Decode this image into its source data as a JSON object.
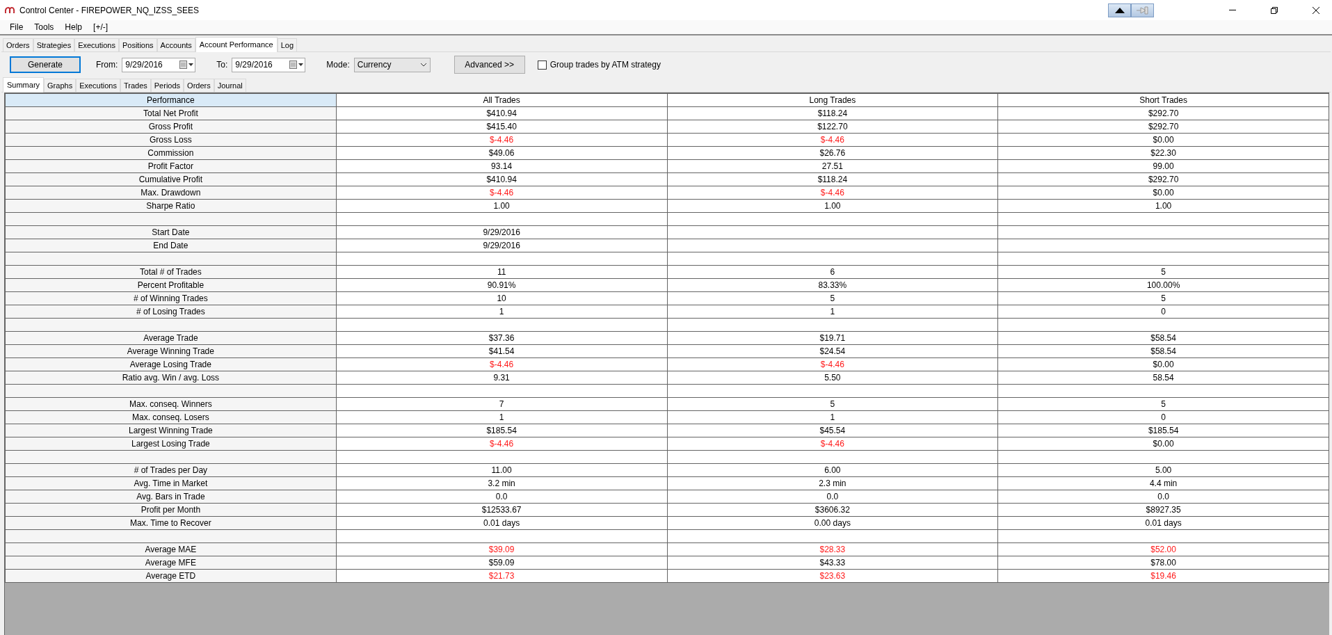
{
  "window": {
    "title": "Control Center - FIREPOWER_NQ_IZSS_SEES"
  },
  "menu": [
    "File",
    "Tools",
    "Help",
    "[+/-]"
  ],
  "tabs": [
    {
      "label": "Orders",
      "selected": false
    },
    {
      "label": "Strategies",
      "selected": false
    },
    {
      "label": "Executions",
      "selected": false
    },
    {
      "label": "Positions",
      "selected": false
    },
    {
      "label": "Accounts",
      "selected": false
    },
    {
      "label": "Account Performance",
      "selected": true
    },
    {
      "label": "Log",
      "selected": false
    }
  ],
  "toolbar": {
    "generate": "Generate",
    "from_label": "From:",
    "from": "9/29/2016",
    "to_label": "To:",
    "to": "9/29/2016",
    "mode_label": "Mode:",
    "mode": "Currency",
    "advanced": "Advanced >>",
    "group_atm": {
      "label": "Group trades by ATM strategy",
      "checked": false
    }
  },
  "subtabs": [
    {
      "label": "Summary",
      "selected": true
    },
    {
      "label": "Graphs",
      "selected": false
    },
    {
      "label": "Executions",
      "selected": false
    },
    {
      "label": "Trades",
      "selected": false
    },
    {
      "label": "Periods",
      "selected": false
    },
    {
      "label": "Orders",
      "selected": false
    },
    {
      "label": "Journal",
      "selected": false
    }
  ],
  "table": {
    "columns": [
      "Performance",
      "All Trades",
      "Long Trades",
      "Short Trades"
    ],
    "rows": [
      {
        "kind": "data",
        "label": "Total Net Profit",
        "values": [
          {
            "text": "$410.94",
            "negative": false
          },
          {
            "text": "$118.24",
            "negative": false
          },
          {
            "text": "$292.70",
            "negative": false
          }
        ]
      },
      {
        "kind": "data",
        "label": "Gross Profit",
        "values": [
          {
            "text": "$415.40",
            "negative": false
          },
          {
            "text": "$122.70",
            "negative": false
          },
          {
            "text": "$292.70",
            "negative": false
          }
        ]
      },
      {
        "kind": "data",
        "label": "Gross Loss",
        "values": [
          {
            "text": "$-4.46",
            "negative": true
          },
          {
            "text": "$-4.46",
            "negative": true
          },
          {
            "text": "$0.00",
            "negative": false
          }
        ]
      },
      {
        "kind": "data",
        "label": "Commission",
        "values": [
          {
            "text": "$49.06",
            "negative": false
          },
          {
            "text": "$26.76",
            "negative": false
          },
          {
            "text": "$22.30",
            "negative": false
          }
        ]
      },
      {
        "kind": "data",
        "label": "Profit Factor",
        "values": [
          {
            "text": "93.14",
            "negative": false
          },
          {
            "text": "27.51",
            "negative": false
          },
          {
            "text": "99.00",
            "negative": false
          }
        ]
      },
      {
        "kind": "data",
        "label": "Cumulative Profit",
        "values": [
          {
            "text": "$410.94",
            "negative": false
          },
          {
            "text": "$118.24",
            "negative": false
          },
          {
            "text": "$292.70",
            "negative": false
          }
        ]
      },
      {
        "kind": "data",
        "label": "Max. Drawdown",
        "values": [
          {
            "text": "$-4.46",
            "negative": true
          },
          {
            "text": "$-4.46",
            "negative": true
          },
          {
            "text": "$0.00",
            "negative": false
          }
        ]
      },
      {
        "kind": "data",
        "label": "Sharpe Ratio",
        "values": [
          {
            "text": "1.00",
            "negative": false
          },
          {
            "text": "1.00",
            "negative": false
          },
          {
            "text": "1.00",
            "negative": false
          }
        ]
      },
      {
        "kind": "blank"
      },
      {
        "kind": "data",
        "label": "Start Date",
        "values": [
          {
            "text": "9/29/2016",
            "negative": false
          }
        ]
      },
      {
        "kind": "data",
        "label": "End Date",
        "values": [
          {
            "text": "9/29/2016",
            "negative": false
          }
        ]
      },
      {
        "kind": "blank"
      },
      {
        "kind": "data",
        "label": "Total # of Trades",
        "values": [
          {
            "text": "11",
            "negative": false
          },
          {
            "text": "6",
            "negative": false
          },
          {
            "text": "5",
            "negative": false
          }
        ]
      },
      {
        "kind": "data",
        "label": "Percent Profitable",
        "values": [
          {
            "text": "90.91%",
            "negative": false
          },
          {
            "text": "83.33%",
            "negative": false
          },
          {
            "text": "100.00%",
            "negative": false
          }
        ]
      },
      {
        "kind": "data",
        "label": "# of Winning Trades",
        "values": [
          {
            "text": "10",
            "negative": false
          },
          {
            "text": "5",
            "negative": false
          },
          {
            "text": "5",
            "negative": false
          }
        ]
      },
      {
        "kind": "data",
        "label": "# of Losing Trades",
        "values": [
          {
            "text": "1",
            "negative": false
          },
          {
            "text": "1",
            "negative": false
          },
          {
            "text": "0",
            "negative": false
          }
        ]
      },
      {
        "kind": "blank"
      },
      {
        "kind": "data",
        "label": "Average Trade",
        "values": [
          {
            "text": "$37.36",
            "negative": false
          },
          {
            "text": "$19.71",
            "negative": false
          },
          {
            "text": "$58.54",
            "negative": false
          }
        ]
      },
      {
        "kind": "data",
        "label": "Average Winning Trade",
        "values": [
          {
            "text": "$41.54",
            "negative": false
          },
          {
            "text": "$24.54",
            "negative": false
          },
          {
            "text": "$58.54",
            "negative": false
          }
        ]
      },
      {
        "kind": "data",
        "label": "Average Losing Trade",
        "values": [
          {
            "text": "$-4.46",
            "negative": true
          },
          {
            "text": "$-4.46",
            "negative": true
          },
          {
            "text": "$0.00",
            "negative": false
          }
        ]
      },
      {
        "kind": "data",
        "label": "Ratio avg. Win / avg. Loss",
        "values": [
          {
            "text": "9.31",
            "negative": false
          },
          {
            "text": "5.50",
            "negative": false
          },
          {
            "text": "58.54",
            "negative": false
          }
        ]
      },
      {
        "kind": "blank"
      },
      {
        "kind": "data",
        "label": "Max. conseq. Winners",
        "values": [
          {
            "text": "7",
            "negative": false
          },
          {
            "text": "5",
            "negative": false
          },
          {
            "text": "5",
            "negative": false
          }
        ]
      },
      {
        "kind": "data",
        "label": "Max. conseq. Losers",
        "values": [
          {
            "text": "1",
            "negative": false
          },
          {
            "text": "1",
            "negative": false
          },
          {
            "text": "0",
            "negative": false
          }
        ]
      },
      {
        "kind": "data",
        "label": "Largest Winning Trade",
        "values": [
          {
            "text": "$185.54",
            "negative": false
          },
          {
            "text": "$45.54",
            "negative": false
          },
          {
            "text": "$185.54",
            "negative": false
          }
        ]
      },
      {
        "kind": "data",
        "label": "Largest Losing Trade",
        "values": [
          {
            "text": "$-4.46",
            "negative": true
          },
          {
            "text": "$-4.46",
            "negative": true
          },
          {
            "text": "$0.00",
            "negative": false
          }
        ]
      },
      {
        "kind": "blank"
      },
      {
        "kind": "data",
        "label": "# of Trades per Day",
        "values": [
          {
            "text": "11.00",
            "negative": false
          },
          {
            "text": "6.00",
            "negative": false
          },
          {
            "text": "5.00",
            "negative": false
          }
        ]
      },
      {
        "kind": "data",
        "label": "Avg. Time in Market",
        "values": [
          {
            "text": "3.2 min",
            "negative": false
          },
          {
            "text": "2.3 min",
            "negative": false
          },
          {
            "text": "4.4 min",
            "negative": false
          }
        ]
      },
      {
        "kind": "data",
        "label": "Avg. Bars in Trade",
        "values": [
          {
            "text": "0.0",
            "negative": false
          },
          {
            "text": "0.0",
            "negative": false
          },
          {
            "text": "0.0",
            "negative": false
          }
        ]
      },
      {
        "kind": "data",
        "label": "Profit per Month",
        "values": [
          {
            "text": "$12533.67",
            "negative": false
          },
          {
            "text": "$3606.32",
            "negative": false
          },
          {
            "text": "$8927.35",
            "negative": false
          }
        ]
      },
      {
        "kind": "data",
        "label": "Max. Time to Recover",
        "values": [
          {
            "text": "0.01 days",
            "negative": false
          },
          {
            "text": "0.00 days",
            "negative": false
          },
          {
            "text": "0.01 days",
            "negative": false
          }
        ]
      },
      {
        "kind": "blank"
      },
      {
        "kind": "data",
        "label": "Average MAE",
        "values": [
          {
            "text": "$39.09",
            "negative": true
          },
          {
            "text": "$28.33",
            "negative": true
          },
          {
            "text": "$52.00",
            "negative": true
          }
        ]
      },
      {
        "kind": "data",
        "label": "Average MFE",
        "values": [
          {
            "text": "$59.09",
            "negative": false
          },
          {
            "text": "$43.33",
            "negative": false
          },
          {
            "text": "$78.00",
            "negative": false
          }
        ]
      },
      {
        "kind": "data",
        "label": "Average ETD",
        "values": [
          {
            "text": "$21.73",
            "negative": true
          },
          {
            "text": "$23.63",
            "negative": true
          },
          {
            "text": "$19.46",
            "negative": true
          }
        ]
      }
    ]
  }
}
